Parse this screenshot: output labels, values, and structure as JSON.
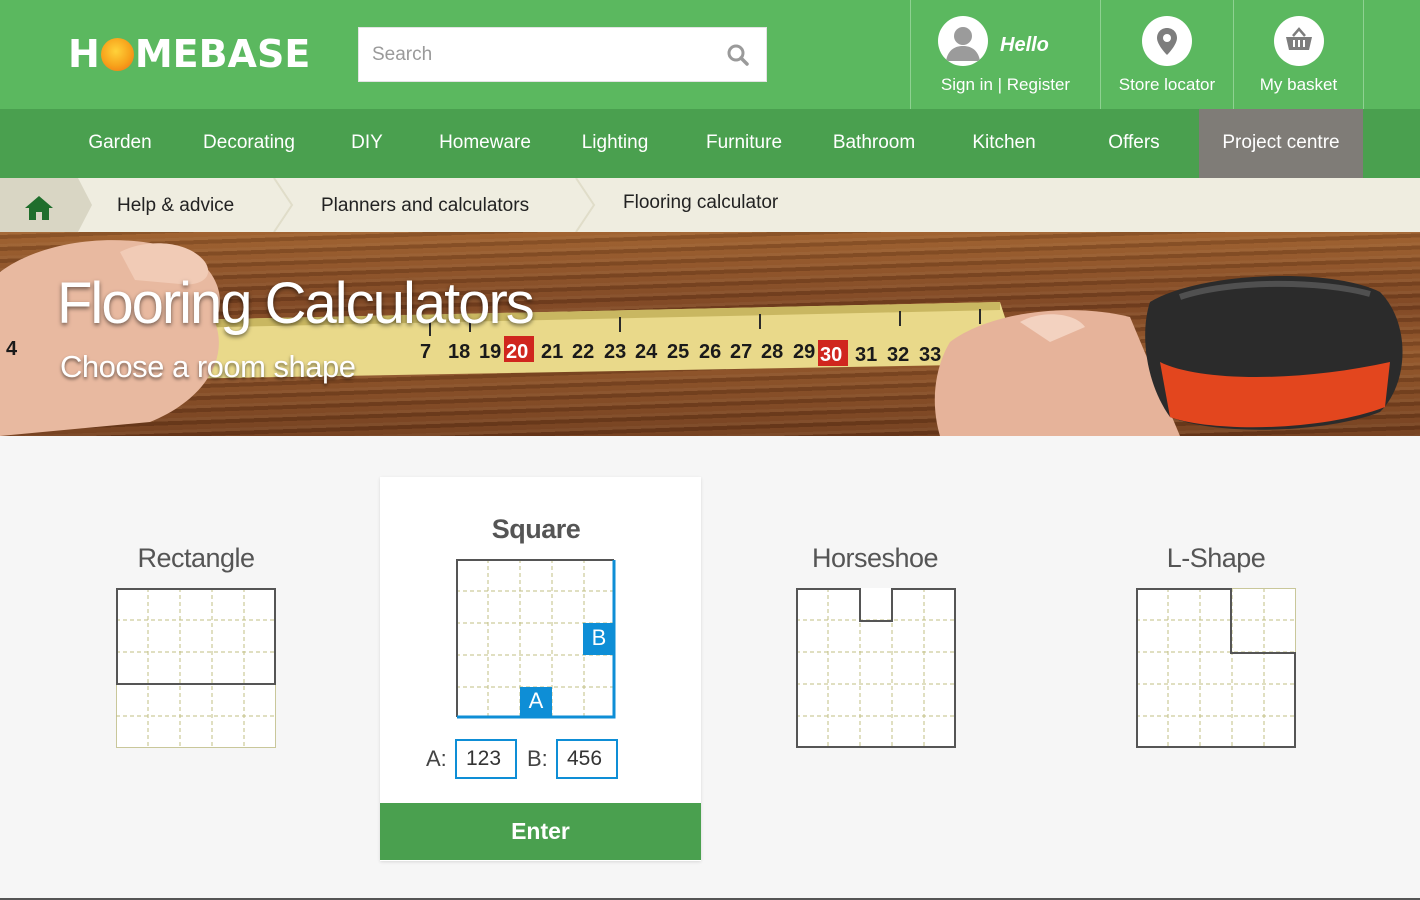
{
  "header": {
    "logo_left": "H",
    "logo_right": "MEBASE",
    "search_placeholder": "Search",
    "hello": "Hello",
    "signin": "Sign in | Register",
    "store_locator": "Store locator",
    "basket": "My basket"
  },
  "nav": [
    "Garden",
    "Decorating",
    "DIY",
    "Homeware",
    "Lighting",
    "Furniture",
    "Bathroom",
    "Kitchen",
    "Offers",
    "Project centre"
  ],
  "breadcrumb": [
    "Help & advice",
    "Planners and calculators",
    "Flooring calculator"
  ],
  "hero": {
    "title": "Flooring Calculators",
    "subtitle": "Choose a room shape"
  },
  "shapes": {
    "rectangle": "Rectangle",
    "square": "Square",
    "horseshoe": "Horseshoe",
    "lshape": "L-Shape"
  },
  "square_form": {
    "marker_a": "A",
    "marker_b": "B",
    "label_a": "A:",
    "label_b": "B:",
    "value_a": "123",
    "value_b": "456",
    "enter": "Enter"
  },
  "colors": {
    "header_green": "#5bb85f",
    "nav_green": "#4aa04f",
    "active_nav": "#7f7c77",
    "accent_blue": "#0e8ed6"
  }
}
